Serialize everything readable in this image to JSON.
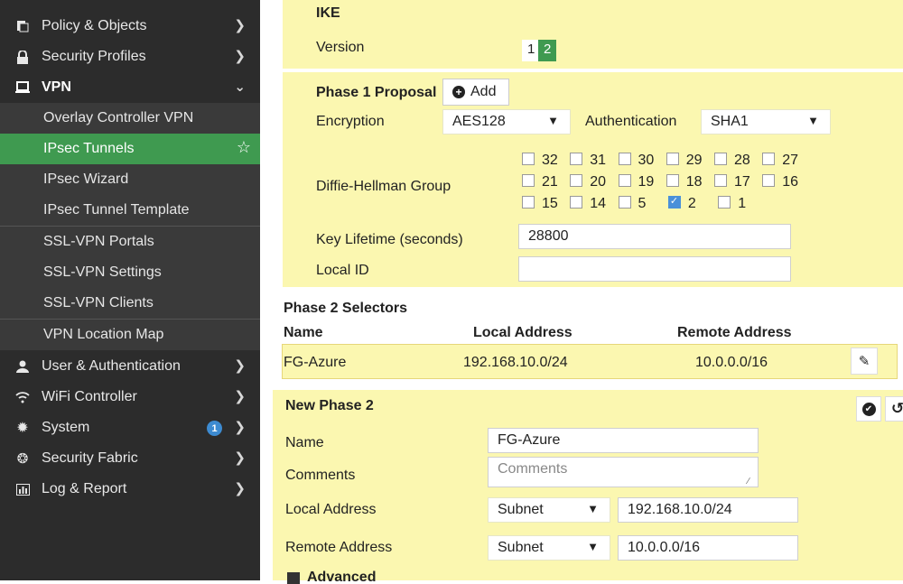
{
  "sidebar": {
    "items": [
      {
        "label": "Policy & Objects",
        "icon": "policy-icon"
      },
      {
        "label": "Security Profiles",
        "icon": "lock-icon"
      },
      {
        "label": "VPN",
        "icon": "monitor-icon"
      },
      {
        "label": "Overlay Controller VPN"
      },
      {
        "label": "IPsec Tunnels"
      },
      {
        "label": "IPsec Wizard"
      },
      {
        "label": "IPsec Tunnel Template"
      },
      {
        "label": "SSL-VPN Portals"
      },
      {
        "label": "SSL-VPN Settings"
      },
      {
        "label": "SSL-VPN Clients"
      },
      {
        "label": "VPN Location Map"
      },
      {
        "label": "User & Authentication",
        "icon": "user-icon"
      },
      {
        "label": "WiFi Controller",
        "icon": "wifi-icon"
      },
      {
        "label": "System",
        "icon": "gear-icon",
        "badge": "1"
      },
      {
        "label": "Security Fabric",
        "icon": "fabric-icon"
      },
      {
        "label": "Log & Report",
        "icon": "chart-icon"
      }
    ]
  },
  "ike": {
    "title": "IKE",
    "version_label": "Version",
    "versions": [
      "1",
      "2"
    ],
    "selected_version": "2"
  },
  "phase1": {
    "title": "Phase 1 Proposal",
    "add_label": "Add",
    "encryption_label": "Encryption",
    "encryption_value": "AES128",
    "auth_label": "Authentication",
    "auth_value": "SHA1",
    "dh_label": "Diffie-Hellman Group",
    "dh_rows": [
      [
        {
          "v": "32",
          "on": false
        },
        {
          "v": "31",
          "on": false
        },
        {
          "v": "30",
          "on": false
        },
        {
          "v": "29",
          "on": false
        },
        {
          "v": "28",
          "on": false
        },
        {
          "v": "27",
          "on": false
        }
      ],
      [
        {
          "v": "21",
          "on": false
        },
        {
          "v": "20",
          "on": false
        },
        {
          "v": "19",
          "on": false
        },
        {
          "v": "18",
          "on": false
        },
        {
          "v": "17",
          "on": false
        },
        {
          "v": "16",
          "on": false
        }
      ],
      [
        {
          "v": "15",
          "on": false
        },
        {
          "v": "14",
          "on": false
        },
        {
          "v": "5",
          "on": false
        },
        {
          "v": "2",
          "on": true
        },
        {
          "v": "1",
          "on": false
        }
      ]
    ],
    "lifetime_label": "Key Lifetime (seconds)",
    "lifetime_value": "28800",
    "localid_label": "Local ID",
    "localid_value": ""
  },
  "phase2_selectors": {
    "title": "Phase 2 Selectors",
    "headers": [
      "Name",
      "Local Address",
      "Remote Address"
    ],
    "rows": [
      [
        "FG-Azure",
        "192.168.10.0/24",
        "10.0.0.0/16"
      ]
    ]
  },
  "new_phase2": {
    "title": "New Phase 2",
    "name_label": "Name",
    "name_value": "FG-Azure",
    "comments_label": "Comments",
    "comments_placeholder": "Comments",
    "local_label": "Local Address",
    "local_type": "Subnet",
    "local_value": "192.168.10.0/24",
    "remote_label": "Remote Address",
    "remote_type": "Subnet",
    "remote_value": "10.0.0.0/16",
    "advanced_label": "Advanced"
  },
  "colors": {
    "accent_green": "#3f9a50",
    "panel_yellow": "#fbf7b0",
    "sidebar_bg": "#2c2c2c"
  }
}
